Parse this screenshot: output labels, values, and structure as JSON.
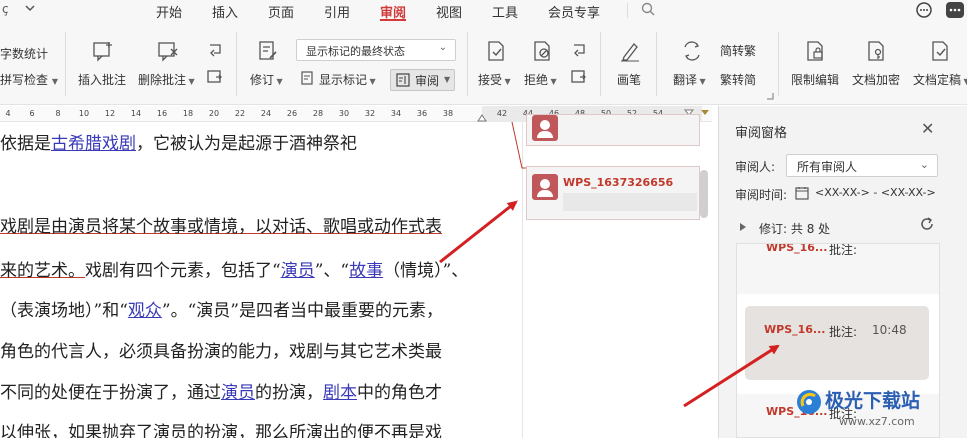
{
  "menubar": {
    "back_glyph": "ç",
    "items": [
      "开始",
      "插入",
      "页面",
      "引用",
      "审阅",
      "视图",
      "工具",
      "会员专享"
    ],
    "active_item": "审阅",
    "accent_color": "#d23a3a"
  },
  "ribbon": {
    "word_count": "字数统计",
    "spell_check": "拼写检查",
    "insert_comment": "插入批注",
    "delete_comment": "删除批注",
    "revise": "修订",
    "display_markup_state": "显示标记的最终状态",
    "show_markup": "显示标记",
    "review": "审阅",
    "accept": "接受",
    "reject": "拒绝",
    "pen": "画笔",
    "translate": "翻译",
    "to_traditional": "简转繁",
    "to_simplified": "繁转简",
    "restrict_edit": "限制编辑",
    "doc_encrypt": "文档加密",
    "doc_finalize": "文档定稿"
  },
  "ruler": {
    "ticks": [
      "4",
      "6",
      "8",
      "10",
      "12",
      "14",
      "16",
      "18",
      "20",
      "22",
      "24",
      "26",
      "28",
      "30",
      "32",
      "34",
      "36",
      "38",
      "42",
      "44",
      "46",
      "48",
      "50",
      "52",
      "54"
    ]
  },
  "document": {
    "l1a": "依据是",
    "l1_link": "古希腊戏剧",
    "l1b": "，它被认为是起源于酒神祭祀",
    "l2": "戏剧是由演员将某个故事或情境，以对话、歌唱或动作式表",
    "l3a": "来的艺术。",
    "l3b": "戏剧有四个元素，包括了“",
    "l3_link1": "演员",
    "l3c": "”、“",
    "l3_link2": "故事",
    "l3d": "（情境）”、",
    "l4a": "（表演场地）”和“",
    "l4_link": "观众",
    "l4b": "”。“演员”是四者当中最重要的元素，",
    "l5": "角色的代言人，必须具备扮演的能力，戏剧与其它艺术类最",
    "l6a": "不同的处便在于扮演了，通过",
    "l6_link1": "演员",
    "l6b": "的扮演，",
    "l6_link2": "剧本",
    "l6c": "中的角色才",
    "l7": "以伸张，如果抛弃了演员的扮演，那么所演出的便不再是戏"
  },
  "comments": [
    {
      "author": "WPS_1637326656"
    }
  ],
  "review_pane": {
    "title": "审阅窗格",
    "reviewer_label": "审阅人:",
    "reviewer_value": "所有审阅人",
    "time_label": "审阅时间:",
    "time_range": "<XX-XX-> - <XX-XX->",
    "revisions_label": "修订:",
    "revisions_count": "共 8 处",
    "items": [
      {
        "name": "WPS_16...",
        "label": "批注:",
        "time": ""
      },
      {
        "name": "WPS_16...",
        "label": "批注:",
        "time": "10:48"
      },
      {
        "name": "WPS_16...",
        "label": "批注:",
        "time": ""
      }
    ]
  },
  "watermark": {
    "title": "极光下载站",
    "url": "www.xz7.com"
  }
}
